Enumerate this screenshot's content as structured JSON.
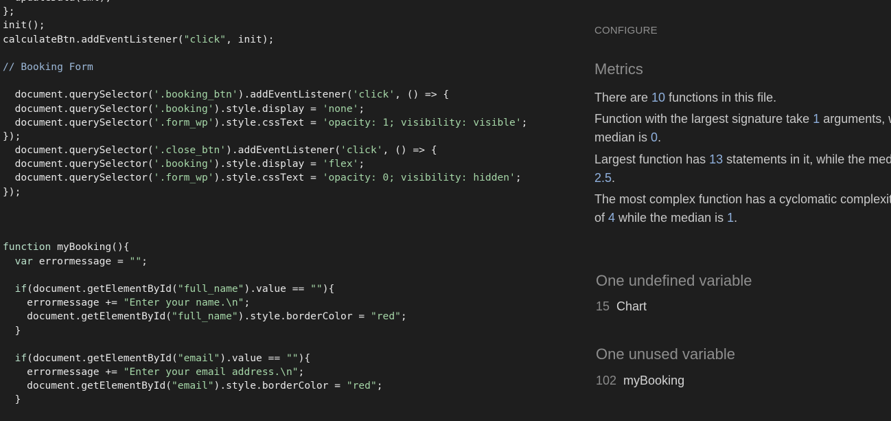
{
  "code": {
    "lines": [
      [
        {
          "t": "  updateData(eml);",
          "c": "plain"
        }
      ],
      [
        {
          "t": "};",
          "c": "plain"
        }
      ],
      [
        {
          "t": "init();",
          "c": "plain"
        }
      ],
      [
        {
          "t": "calculateBtn.addEventListener(",
          "c": "plain"
        },
        {
          "t": "\"click\"",
          "c": "str"
        },
        {
          "t": ", init);",
          "c": "plain"
        }
      ],
      [
        {
          "t": "",
          "c": "plain"
        }
      ],
      [
        {
          "t": "// Booking Form",
          "c": "com"
        }
      ],
      [
        {
          "t": "",
          "c": "plain"
        }
      ],
      [
        {
          "t": "  document.querySelector(",
          "c": "plain"
        },
        {
          "t": "'.booking_btn'",
          "c": "str"
        },
        {
          "t": ").addEventListener(",
          "c": "plain"
        },
        {
          "t": "'click'",
          "c": "str"
        },
        {
          "t": ", () => {",
          "c": "plain"
        }
      ],
      [
        {
          "t": "  document.querySelector(",
          "c": "plain"
        },
        {
          "t": "'.booking'",
          "c": "str"
        },
        {
          "t": ").style.display = ",
          "c": "plain"
        },
        {
          "t": "'none'",
          "c": "str"
        },
        {
          "t": ";",
          "c": "plain"
        }
      ],
      [
        {
          "t": "  document.querySelector(",
          "c": "plain"
        },
        {
          "t": "'.form_wp'",
          "c": "str"
        },
        {
          "t": ").style.cssText = ",
          "c": "plain"
        },
        {
          "t": "'opacity: 1; visibility: visible'",
          "c": "str"
        },
        {
          "t": ";",
          "c": "plain"
        }
      ],
      [
        {
          "t": "});",
          "c": "plain"
        }
      ],
      [
        {
          "t": "  document.querySelector(",
          "c": "plain"
        },
        {
          "t": "'.close_btn'",
          "c": "str"
        },
        {
          "t": ").addEventListener(",
          "c": "plain"
        },
        {
          "t": "'click'",
          "c": "str"
        },
        {
          "t": ", () => {",
          "c": "plain"
        }
      ],
      [
        {
          "t": "  document.querySelector(",
          "c": "plain"
        },
        {
          "t": "'.booking'",
          "c": "str"
        },
        {
          "t": ").style.display = ",
          "c": "plain"
        },
        {
          "t": "'flex'",
          "c": "str"
        },
        {
          "t": ";",
          "c": "plain"
        }
      ],
      [
        {
          "t": "  document.querySelector(",
          "c": "plain"
        },
        {
          "t": "'.form_wp'",
          "c": "str"
        },
        {
          "t": ").style.cssText = ",
          "c": "plain"
        },
        {
          "t": "'opacity: 0; visibility: hidden'",
          "c": "str"
        },
        {
          "t": ";",
          "c": "plain"
        }
      ],
      [
        {
          "t": "});",
          "c": "plain"
        }
      ],
      [
        {
          "t": "",
          "c": "plain"
        }
      ],
      [
        {
          "t": "",
          "c": "plain"
        }
      ],
      [
        {
          "t": "",
          "c": "plain"
        }
      ],
      [
        {
          "t": "function",
          "c": "kw"
        },
        {
          "t": " myBooking(){",
          "c": "plain"
        }
      ],
      [
        {
          "t": "  ",
          "c": "plain"
        },
        {
          "t": "var",
          "c": "kw"
        },
        {
          "t": " errormessage = ",
          "c": "plain"
        },
        {
          "t": "\"\"",
          "c": "str"
        },
        {
          "t": ";",
          "c": "plain"
        }
      ],
      [
        {
          "t": "",
          "c": "plain"
        }
      ],
      [
        {
          "t": "  ",
          "c": "plain"
        },
        {
          "t": "if",
          "c": "kw"
        },
        {
          "t": "(document.getElementById(",
          "c": "plain"
        },
        {
          "t": "\"full_name\"",
          "c": "str"
        },
        {
          "t": ").value == ",
          "c": "plain"
        },
        {
          "t": "\"\"",
          "c": "str"
        },
        {
          "t": "){",
          "c": "plain"
        }
      ],
      [
        {
          "t": "    errormessage += ",
          "c": "plain"
        },
        {
          "t": "\"Enter your name.\\n\"",
          "c": "str"
        },
        {
          "t": ";",
          "c": "plain"
        }
      ],
      [
        {
          "t": "    document.getElementById(",
          "c": "plain"
        },
        {
          "t": "\"full_name\"",
          "c": "str"
        },
        {
          "t": ").style.borderColor = ",
          "c": "plain"
        },
        {
          "t": "\"red\"",
          "c": "str"
        },
        {
          "t": ";",
          "c": "plain"
        }
      ],
      [
        {
          "t": "  }",
          "c": "plain"
        }
      ],
      [
        {
          "t": "",
          "c": "plain"
        }
      ],
      [
        {
          "t": "  ",
          "c": "plain"
        },
        {
          "t": "if",
          "c": "kw"
        },
        {
          "t": "(document.getElementById(",
          "c": "plain"
        },
        {
          "t": "\"email\"",
          "c": "str"
        },
        {
          "t": ").value == ",
          "c": "plain"
        },
        {
          "t": "\"\"",
          "c": "str"
        },
        {
          "t": "){",
          "c": "plain"
        }
      ],
      [
        {
          "t": "    errormessage += ",
          "c": "plain"
        },
        {
          "t": "\"Enter your email address.\\n\"",
          "c": "str"
        },
        {
          "t": ";",
          "c": "plain"
        }
      ],
      [
        {
          "t": "    document.getElementById(",
          "c": "plain"
        },
        {
          "t": "\"email\"",
          "c": "str"
        },
        {
          "t": ").style.borderColor = ",
          "c": "plain"
        },
        {
          "t": "\"red\"",
          "c": "str"
        },
        {
          "t": ";",
          "c": "plain"
        }
      ],
      [
        {
          "t": "  }",
          "c": "plain"
        }
      ]
    ]
  },
  "report": {
    "configure_label": "CONFIGURE",
    "metrics_title": "Metrics",
    "functions_count": {
      "pre": "There are ",
      "value": "10",
      "post": " functions in this file."
    },
    "signature": {
      "line1_pre": "Function with the largest signature take ",
      "value": "1",
      "line1_post": " arguments, while the",
      "line2_pre": "median is ",
      "median": "0",
      "line2_post": "."
    },
    "statements": {
      "line1_pre": "Largest function has ",
      "value": "13",
      "line1_post": " statements in it, while the median is",
      "median": "2.5",
      "line2_post": "."
    },
    "complexity": {
      "line1": "The most complex function has a cyclomatic complexity value",
      "line2_pre": "of ",
      "value": "4",
      "line2_mid": " while the median is ",
      "median": "1",
      "line2_post": "."
    },
    "undefined_title": "One undefined variable",
    "undefined_var": {
      "line": "15",
      "name": "Chart"
    },
    "unused_title": "One unused variable",
    "unused_var": {
      "line": "102",
      "name": "myBooking"
    }
  },
  "colors": {
    "background": "#1e1e1e",
    "code_text": "#e8e8e8",
    "code_string": "#a5d6a7",
    "code_comment": "#9cb8d8",
    "muted_heading": "#8e8e8e",
    "body_text": "#c8c8c8",
    "number_accent": "#8fb0dd"
  }
}
